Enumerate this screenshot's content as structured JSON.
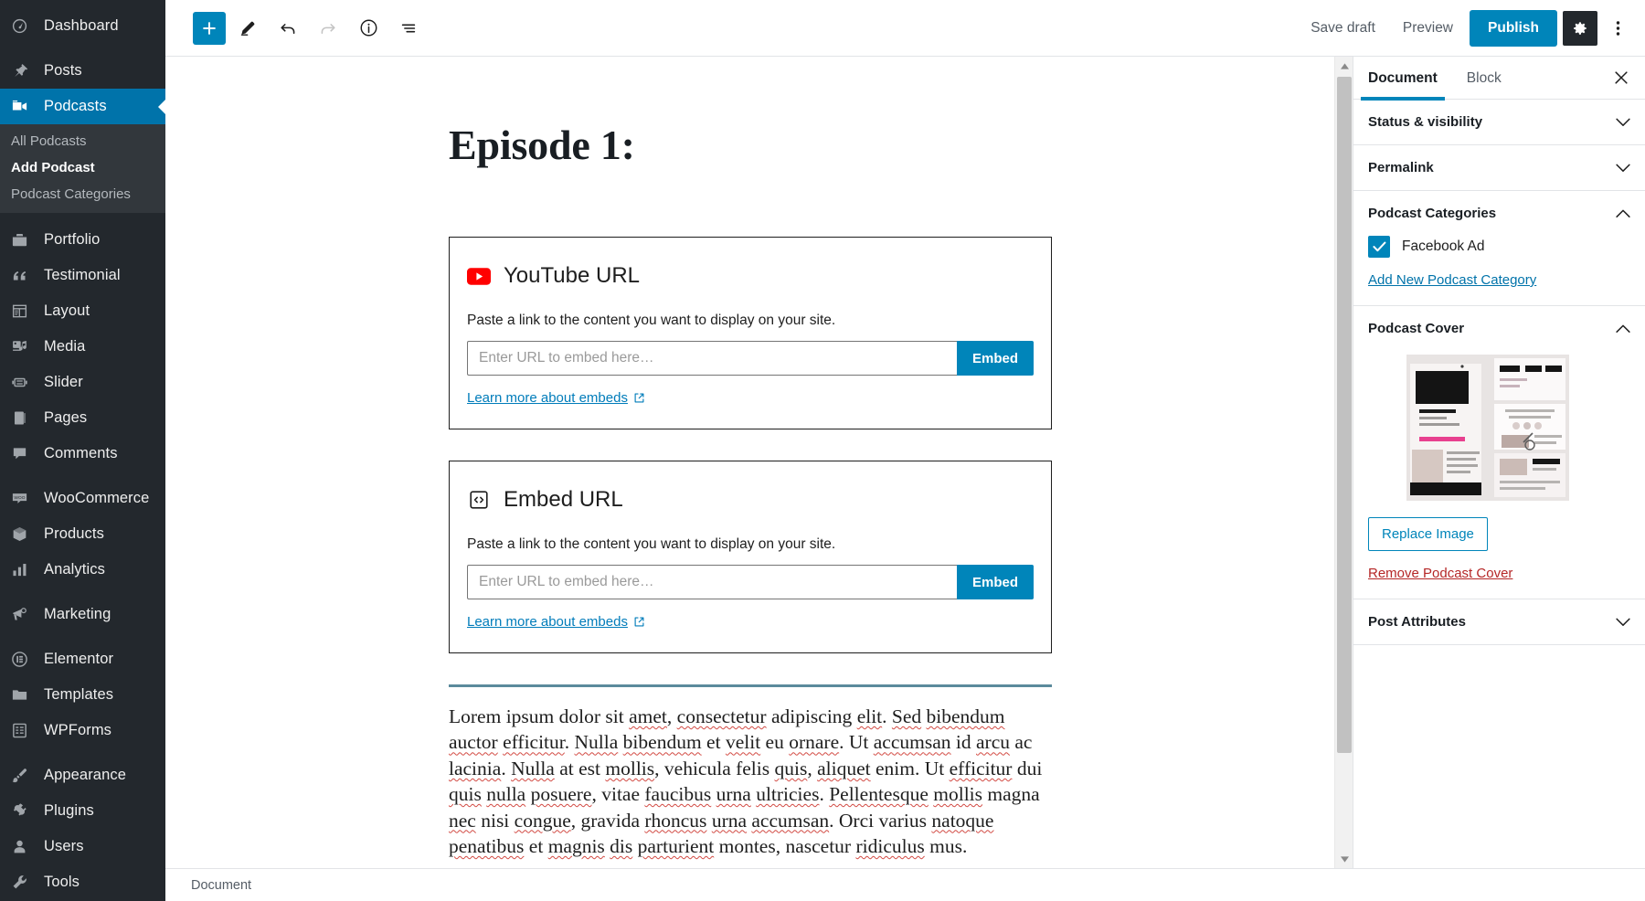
{
  "admin_sidebar": {
    "items": [
      {
        "label": "Dashboard",
        "icon": "dashboard-icon",
        "current": false
      },
      {
        "label": "Posts",
        "icon": "pin-icon",
        "current": false
      },
      {
        "label": "Podcasts",
        "icon": "video-camera-icon",
        "current": true
      },
      {
        "label": "Portfolio",
        "icon": "portfolio-icon",
        "current": false
      },
      {
        "label": "Testimonial",
        "icon": "quote-icon",
        "current": false
      },
      {
        "label": "Layout",
        "icon": "layout-icon",
        "current": false
      },
      {
        "label": "Media",
        "icon": "media-icon",
        "current": false
      },
      {
        "label": "Slider",
        "icon": "slider-icon",
        "current": false
      },
      {
        "label": "Pages",
        "icon": "pages-icon",
        "current": false
      },
      {
        "label": "Comments",
        "icon": "comment-icon",
        "current": false
      },
      {
        "label": "WooCommerce",
        "icon": "woocommerce-icon",
        "current": false
      },
      {
        "label": "Products",
        "icon": "products-box-icon",
        "current": false
      },
      {
        "label": "Analytics",
        "icon": "bar-chart-icon",
        "current": false
      },
      {
        "label": "Marketing",
        "icon": "megaphone-icon",
        "current": false
      },
      {
        "label": "Elementor",
        "icon": "elementor-icon",
        "current": false
      },
      {
        "label": "Templates",
        "icon": "folder-icon",
        "current": false
      },
      {
        "label": "WPForms",
        "icon": "wpforms-icon",
        "current": false
      },
      {
        "label": "Appearance",
        "icon": "paintbrush-icon",
        "current": false
      },
      {
        "label": "Plugins",
        "icon": "plug-icon",
        "current": false
      },
      {
        "label": "Users",
        "icon": "user-icon",
        "current": false
      },
      {
        "label": "Tools",
        "icon": "wrench-icon",
        "current": false
      }
    ],
    "submenu": {
      "parent": "Podcasts",
      "items": [
        {
          "label": "All Podcasts",
          "current": false
        },
        {
          "label": "Add Podcast",
          "current": true
        },
        {
          "label": "Podcast Categories",
          "current": false
        }
      ]
    }
  },
  "toolbar": {
    "add_block_icon": "plus-icon",
    "edit_icon": "pencil-icon",
    "undo_icon": "undo-arrow-icon",
    "redo_icon": "redo-arrow-icon",
    "info_icon": "info-circle-icon",
    "block_navigation_icon": "block-navigation-icon",
    "save_draft_label": "Save draft",
    "preview_label": "Preview",
    "publish_label": "Publish",
    "settings_gear_icon": "gear-icon",
    "more_options_icon": "ellipsis-vertical-icon"
  },
  "canvas": {
    "post_title": "Episode 1:",
    "blocks": [
      {
        "type": "youtube-embed",
        "icon": "youtube-icon",
        "title": "YouTube URL",
        "description": "Paste a link to the content you want to display on your site.",
        "input_value": "",
        "input_placeholder": "Enter URL to embed here…",
        "submit_label": "Embed",
        "learn_more_label": "Learn more about embeds",
        "external_link_icon": "external-link-icon"
      },
      {
        "type": "generic-embed",
        "icon": "code-embed-icon",
        "title": "Embed URL",
        "description": "Paste a link to the content you want to display on your site.",
        "input_value": "",
        "input_placeholder": "Enter URL to embed here…",
        "submit_label": "Embed",
        "learn_more_label": "Learn more about embeds",
        "external_link_icon": "external-link-icon"
      }
    ],
    "separator_color": "#5b8a9c",
    "paragraph": "Lorem ipsum dolor sit amet, consectetur adipiscing elit. Sed bibendum auctor efficitur. Nulla bibendum et velit eu ornare. Ut accumsan id arcu ac lacinia. Nulla at est mollis, vehicula felis quis, aliquet enim. Ut efficitur dui quis nulla posuere, vitae faucibus urna ultricies. Pellentesque mollis magna nec nisi congue, gravida rhoncus urna accumsan. Orci varius natoque penatibus et magnis dis parturient montes, nascetur ridiculus mus."
  },
  "settings_sidebar": {
    "tabs": [
      {
        "label": "Document",
        "active": true
      },
      {
        "label": "Block",
        "active": false
      }
    ],
    "close_icon": "close-x-icon",
    "panels": [
      {
        "title": "Status & visibility",
        "expanded": false,
        "chevron": "chevron-down-icon"
      },
      {
        "title": "Permalink",
        "expanded": false,
        "chevron": "chevron-down-icon"
      },
      {
        "title": "Podcast Categories",
        "expanded": true,
        "chevron": "chevron-up-icon"
      },
      {
        "title": "Podcast Cover",
        "expanded": true,
        "chevron": "chevron-up-icon"
      },
      {
        "title": "Post Attributes",
        "expanded": false,
        "chevron": "chevron-down-icon"
      }
    ],
    "podcast_categories": {
      "checkbox_checked": true,
      "checkbox_label": "Facebook Ad",
      "check_icon": "checkmark-icon",
      "add_new_label": "Add New Podcast Category"
    },
    "podcast_cover": {
      "thumbnail_alt": "podcast cover image preview",
      "replace_label": "Replace Image",
      "remove_label": "Remove Podcast Cover"
    }
  },
  "statusbar": {
    "label": "Document"
  },
  "colors": {
    "accent": "#0085ba",
    "admin_bg": "#23282d",
    "admin_submenu_bg": "#32373c",
    "current_menu": "#0073aa",
    "link": "#0073aa",
    "danger": "#b52727",
    "youtube_red": "#ff0000",
    "separator": "#5b8a9c",
    "spellcheck_underline": "#d24a43"
  },
  "scrollbars": {
    "canvas": {
      "up_arrow_icon": "triangle-up-icon",
      "down_arrow_icon": "triangle-down-icon"
    },
    "settings": {
      "up_arrow_icon": "triangle-up-icon",
      "down_arrow_icon": "triangle-down-icon"
    }
  }
}
